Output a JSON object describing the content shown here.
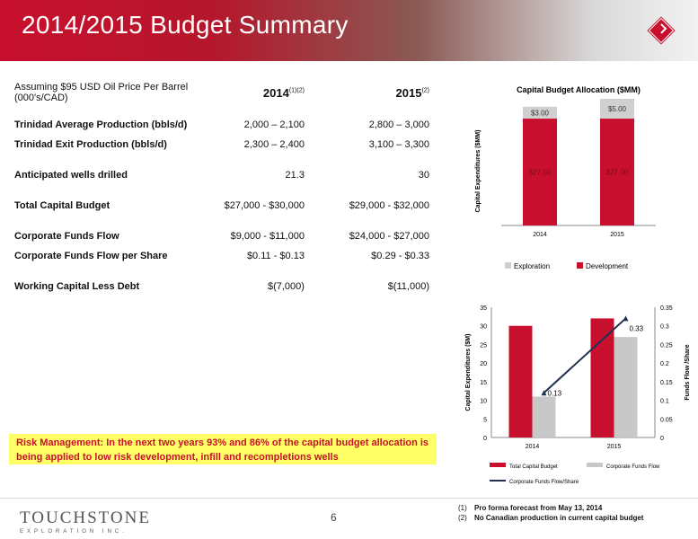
{
  "header": {
    "title": "2014/2015 Budget Summary"
  },
  "table": {
    "header_label": "Assuming $95 USD Oil Price Per Barrel (000's/CAD)",
    "col1": "2014",
    "col1_note": "(1)(2)",
    "col2": "2015",
    "col2_note": "(2)",
    "rows": [
      {
        "label": "Trinidad Average Production (bbls/d)",
        "v2014": "2,000 – 2,100",
        "v2015": "2,800 – 3,000"
      },
      {
        "label": "Trinidad Exit Production (bbls/d)",
        "v2014": "2,300 – 2,400",
        "v2015": "3,100 – 3,300"
      },
      {
        "label": "Anticipated wells drilled",
        "v2014": "21.3",
        "v2015": "30"
      },
      {
        "label": "Total Capital Budget",
        "v2014": "$27,000 - $30,000",
        "v2015": "$29,000 - $32,000"
      },
      {
        "label": "Corporate Funds Flow",
        "v2014": "$9,000 - $11,000",
        "v2015": "$24,000 - $27,000"
      },
      {
        "label": "Corporate Funds Flow per Share",
        "v2014": "$0.11 - $0.13",
        "v2015": "$0.29 - $0.33"
      },
      {
        "label": "Working Capital Less Debt",
        "v2014": "$(7,000)",
        "v2015": "$(11,000)"
      }
    ]
  },
  "callout": "Risk Management: In the next two years 93% and 86% of the capital budget allocation is being applied to low risk development, infill and recompletions wells",
  "chart_data": [
    {
      "type": "bar",
      "stacked": true,
      "title": "Capital Budget Allocation ($MM)",
      "ylabel": "Capital Expenditures ($MM)",
      "categories": [
        "2014",
        "2015"
      ],
      "series": [
        {
          "name": "Development",
          "values": [
            27.0,
            27.0
          ],
          "labels": [
            "$27.00",
            "$27.00"
          ],
          "color": "#c8102e"
        },
        {
          "name": "Exploration",
          "values": [
            3.0,
            5.0
          ],
          "labels": [
            "$3.00",
            "$5.00"
          ],
          "color": "#d0d0d0"
        }
      ],
      "ylim": [
        0,
        32
      ],
      "legend": "bottom"
    },
    {
      "type": "bar",
      "ylabel": "Capital Expenditures ($M)",
      "y2label": "Funds Flow /Share",
      "categories": [
        "2014",
        "2015"
      ],
      "yticks": [
        "0",
        "5",
        "10",
        "15",
        "20",
        "25",
        "30",
        "35"
      ],
      "y2ticks": [
        "0",
        "0.05",
        "0.1",
        "0.15",
        "0.2",
        "0.25",
        "0.3",
        "0.35"
      ],
      "ylim": [
        0,
        35
      ],
      "y2lim": [
        0,
        0.35
      ],
      "series": [
        {
          "name": "Total Capital Budget",
          "values": [
            30,
            32
          ],
          "color": "#c8102e"
        },
        {
          "name": "Corporate Funds Flow",
          "values": [
            11,
            27
          ],
          "color": "#c8c8c8"
        },
        {
          "name": "Corporate Funds Flow/Share",
          "type": "line",
          "axis": "y2",
          "values": [
            0.12,
            0.32
          ],
          "labels": [
            "0.13",
            "0.33"
          ],
          "color": "#1f3050"
        }
      ],
      "legend": "bottom"
    }
  ],
  "footer": {
    "logo_main": "TOUCHSTONE",
    "logo_sub": "EXPLORATION INC.",
    "page": "6",
    "notes": [
      {
        "num": "(1)",
        "text": "Pro forma forecast from May 13, 2014"
      },
      {
        "num": "(2)",
        "text": "No Canadian production in current capital budget"
      }
    ]
  }
}
